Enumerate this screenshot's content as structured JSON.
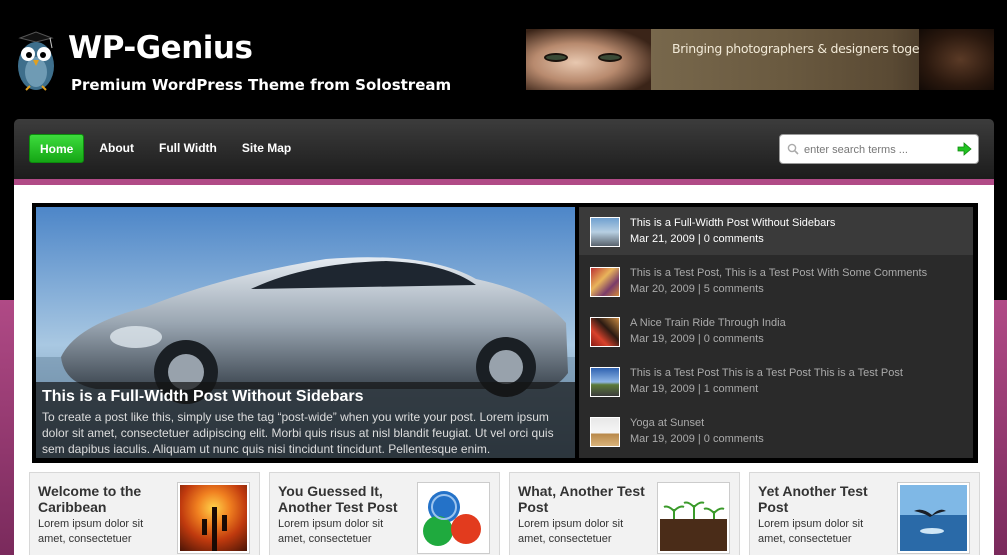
{
  "header": {
    "title": "WP-Genius",
    "tagline": "Premium WordPress Theme from Solostream",
    "banner_text": "Bringing photographers & designers together"
  },
  "nav": {
    "items": [
      {
        "label": "Home",
        "active": true
      },
      {
        "label": "About",
        "active": false
      },
      {
        "label": "Full Width",
        "active": false
      },
      {
        "label": "Site Map",
        "active": false
      }
    ]
  },
  "search": {
    "placeholder": "enter search terms ..."
  },
  "featured": {
    "main": {
      "title": "This is a Full-Width Post Without Sidebars",
      "excerpt": "To create a post like this, simply use the tag “post-wide” when you write your post. Lorem ipsum dolor sit amet, consectetuer adipiscing elit. Morbi quis risus at nisl blandit feugiat. Ut vel orci quis sem dapibus iaculis. Aliquam ut nunc quis nisi tincidunt tincidunt. Pellentesque enim."
    },
    "list": [
      {
        "title": "This is a Full-Width Post Without Sidebars",
        "meta": "Mar 21, 2009 | 0 comments",
        "active": true
      },
      {
        "title": "This is a Test Post, This is a Test Post With Some Comments",
        "meta": "Mar 20, 2009 | 5 comments",
        "active": false
      },
      {
        "title": "A Nice Train Ride Through India",
        "meta": "Mar 19, 2009 | 0 comments",
        "active": false
      },
      {
        "title": "This is a Test Post This is a Test Post This is a Test Post",
        "meta": "Mar 19, 2009 | 1 comment",
        "active": false
      },
      {
        "title": "Yoga at Sunset",
        "meta": "Mar 19, 2009 | 0 comments",
        "active": false
      }
    ]
  },
  "posts": [
    {
      "title": "Welcome to the Caribbean",
      "excerpt": "Lorem ipsum dolor sit amet, consectetuer adipiscing elit. Morbi quis risus at nisl"
    },
    {
      "title": "You Guessed It, Another Test Post",
      "excerpt": "Lorem ipsum dolor sit amet, consectetuer adipiscing elit. Morbi quis risus at nisl"
    },
    {
      "title": "What, Another Test Post",
      "excerpt": "Lorem ipsum dolor sit amet, consectetuer adipiscing elit. Morbi quis risus at nisl"
    },
    {
      "title": "Yet Another Test Post",
      "excerpt": "Lorem ipsum dolor sit amet, consectetuer adipiscing elit. Morbi quis risus at nisl"
    }
  ],
  "colors": {
    "accent_green": "#22c322",
    "nav_stripe": "#b04a86",
    "page_background": "#000000"
  }
}
